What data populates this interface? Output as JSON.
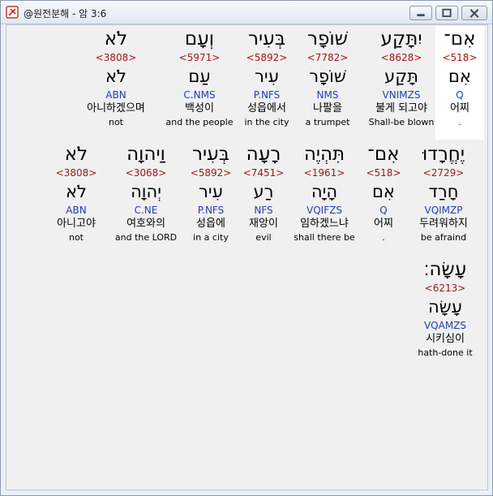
{
  "window": {
    "title": "@원전분해 - 암 3:6"
  },
  "colors": {
    "strong_number": "#a01818",
    "parsing": "#1f3fb7",
    "selected_bg": "#ffffff"
  },
  "words": [
    {
      "heb": "אִם־",
      "strong": "<518>",
      "root": "אִם",
      "parse": "Q",
      "kor": "어찌",
      "eng": ".",
      "selected": true
    },
    {
      "heb": "יִתָּקַע",
      "strong": "<8628>",
      "root": "תָּקַע",
      "parse": "VNIMZS",
      "kor": "불게 되고야",
      "eng": "Shall-be blown"
    },
    {
      "heb": "שׁוֹפָר",
      "strong": "<7782>",
      "root": "שׁוֹפָר",
      "parse": "NMS",
      "kor": "나팔을",
      "eng": "a trumpet"
    },
    {
      "heb": "בְּעִיר",
      "strong": "<5892>",
      "root": "עִיר",
      "parse": "P.NFS",
      "kor": "성읍에서",
      "eng": "in the city"
    },
    {
      "heb": "וְעָם",
      "strong": "<5971>",
      "root": "עַם",
      "parse": "C.NMS",
      "kor": "백성이",
      "eng": "and the people"
    },
    {
      "heb": "לֹא",
      "strong": "<3808>",
      "root": "לֹא",
      "parse": "ABN",
      "kor": "아니하겠으며",
      "eng": "not"
    },
    {
      "heb": "יֶחֱרָדוּ",
      "strong": "<2729>",
      "root": "חָרַד",
      "parse": "VQIMZP",
      "kor": "두려워하지",
      "eng": "be afraind"
    },
    {
      "heb": "אִם־",
      "strong": "<518>",
      "root": "אִם",
      "parse": "Q",
      "kor": "어찌",
      "eng": "."
    },
    {
      "heb": "תִּהְיֶה",
      "strong": "<1961>",
      "root": "הָיָה",
      "parse": "VQIFZS",
      "kor": "임하겠느냐",
      "eng": "shall there be"
    },
    {
      "heb": "רָעָה",
      "strong": "<7451>",
      "root": "רַע",
      "parse": "NFS",
      "kor": "재앙이",
      "eng": "evil"
    },
    {
      "heb": "בְּעִיר",
      "strong": "<5892>",
      "root": "עִיר",
      "parse": "P.NFS",
      "kor": "성읍에",
      "eng": "in a city"
    },
    {
      "heb": "וַיהוָה",
      "strong": "<3068>",
      "root": "יְהוָה",
      "parse": "C.NE",
      "kor": "여호와의",
      "eng": "and the LORD"
    },
    {
      "heb": "לֹא",
      "strong": "<3808>",
      "root": "לֹא",
      "parse": "ABN",
      "kor": "아니고야",
      "eng": "not"
    },
    {
      "heb": "עָשָׂה׃",
      "strong": "<6213>",
      "root": "עָשָׂה",
      "parse": "VQAMZS",
      "kor": "시키심이",
      "eng": "hath-done it"
    }
  ]
}
